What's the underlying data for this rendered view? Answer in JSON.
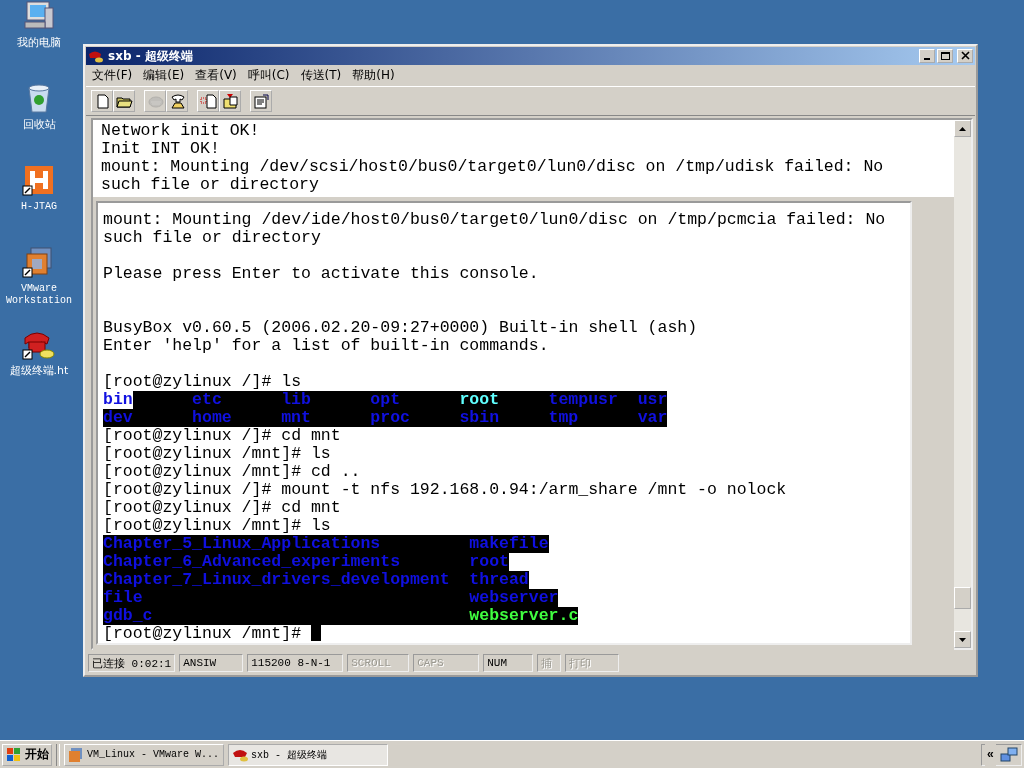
{
  "desktop_icons": [
    {
      "label": "我的电脑"
    },
    {
      "label": "回收站"
    },
    {
      "label": "H-JTAG"
    },
    {
      "label": "VMware Workstation"
    },
    {
      "label": "超级终端.ht"
    }
  ],
  "window": {
    "title": "sxb - 超级终端"
  },
  "menu": [
    "文件(F)",
    "编辑(E)",
    "查看(V)",
    "呼叫(C)",
    "传送(T)",
    "帮助(H)"
  ],
  "toolbar": [
    {
      "disabled": false
    },
    {
      "disabled": false
    },
    {
      "disabled": true
    },
    {
      "disabled": false
    },
    {
      "disabled": false
    },
    {
      "disabled": false
    },
    {
      "disabled": false
    }
  ],
  "terminal": {
    "top_lines": [
      {
        "kind": "text",
        "text": "Network init OK!"
      },
      {
        "kind": "text",
        "text": "Init INT OK!"
      },
      {
        "kind": "text",
        "text": "mount: Mounting /dev/scsi/host0/bus0/target0/lun0/disc on /tmp/udisk failed: No such file or directory"
      }
    ],
    "lines": [
      {
        "kind": "text",
        "text": "mount: Mounting /dev/ide/host0/bus0/target0/lun0/disc on /tmp/pcmcia failed: No such file or directory"
      },
      {
        "kind": "blank"
      },
      {
        "kind": "text",
        "text": "Please press Enter to activate this console."
      },
      {
        "kind": "blank"
      },
      {
        "kind": "blank"
      },
      {
        "kind": "text",
        "text": "BusyBox v0.60.5 (2006.02.20-09:27+0000) Built-in shell (ash)"
      },
      {
        "kind": "text",
        "text": "Enter 'help' for a list of built-in commands."
      },
      {
        "kind": "blank"
      },
      {
        "kind": "command",
        "text": "[root@zylinux /]# ls"
      },
      {
        "kind": "listing",
        "rows": [
          [
            {
              "name": "bin",
              "kind": "dir",
              "inverse": true
            },
            {
              "name": "etc",
              "kind": "dir",
              "inverse": false
            },
            {
              "name": "lib",
              "kind": "dir",
              "inverse": false
            },
            {
              "name": "opt",
              "kind": "dir",
              "inverse": false
            },
            {
              "name": "root",
              "kind": "link",
              "inverse": false
            },
            {
              "name": "tempusr",
              "kind": "dir",
              "inverse": false
            },
            {
              "name": "usr",
              "kind": "dir",
              "inverse": false
            }
          ],
          [
            {
              "name": "dev",
              "kind": "dir",
              "inverse": false
            },
            {
              "name": "home",
              "kind": "dir",
              "inverse": false
            },
            {
              "name": "mnt",
              "kind": "dir",
              "inverse": false
            },
            {
              "name": "proc",
              "kind": "dir",
              "inverse": false
            },
            {
              "name": "sbin",
              "kind": "dir",
              "inverse": false
            },
            {
              "name": "tmp",
              "kind": "dir",
              "inverse": false
            },
            {
              "name": "var",
              "kind": "dir",
              "inverse": false
            }
          ]
        ]
      },
      {
        "kind": "command",
        "text": "[root@zylinux /]# cd mnt"
      },
      {
        "kind": "command",
        "text": "[root@zylinux /mnt]# ls"
      },
      {
        "kind": "command",
        "text": "[root@zylinux /mnt]# cd .."
      },
      {
        "kind": "command",
        "text": "[root@zylinux /]# mount -t nfs 192.168.0.94:/arm_share /mnt -o nolock"
      },
      {
        "kind": "command",
        "text": "[root@zylinux /]# cd mnt"
      },
      {
        "kind": "command",
        "text": "[root@zylinux /mnt]# ls"
      },
      {
        "kind": "listing",
        "rows": [
          [
            {
              "name": "Chapter_5_Linux_Applications",
              "kind": "dir",
              "inverse": false
            },
            {
              "name": "makefile",
              "kind": "dir",
              "inverse": false
            }
          ],
          [
            {
              "name": "Chapter_6_Advanced_experiments",
              "kind": "dir",
              "inverse": false
            },
            {
              "name": "root",
              "kind": "dir",
              "inverse": false
            }
          ],
          [
            {
              "name": "Chapter_7_Linux_drivers_development",
              "kind": "dir",
              "inverse": false
            },
            {
              "name": "thread",
              "kind": "dir",
              "inverse": false
            }
          ],
          [
            {
              "name": "file",
              "kind": "dir",
              "inverse": false
            },
            {
              "name": "webserver",
              "kind": "dir",
              "inverse": false
            }
          ],
          [
            {
              "name": "gdb_c",
              "kind": "dir",
              "inverse": false
            },
            {
              "name": "webserver.c",
              "kind": "exec",
              "inverse": false
            }
          ]
        ]
      },
      {
        "kind": "command",
        "text": "[root@zylinux /mnt]#",
        "cursor": true
      }
    ]
  },
  "status_bar": [
    {
      "text": "已连接 0:02:1",
      "disabled": false
    },
    {
      "text": "ANSIW",
      "disabled": false
    },
    {
      "text": "115200 8-N-1",
      "disabled": false
    },
    {
      "text": "SCROLL",
      "disabled": true
    },
    {
      "text": "CAPS",
      "disabled": true
    },
    {
      "text": "NUM",
      "disabled": false
    },
    {
      "text": "捕",
      "disabled": true
    },
    {
      "text": "打印",
      "disabled": true
    }
  ],
  "taskbar": {
    "start": "开始",
    "tasks": [
      {
        "label": "VM_Linux - VMware W...",
        "selected": false
      },
      {
        "label": "sxb - 超级终端",
        "selected": true
      }
    ],
    "tray_toggle": "«"
  }
}
